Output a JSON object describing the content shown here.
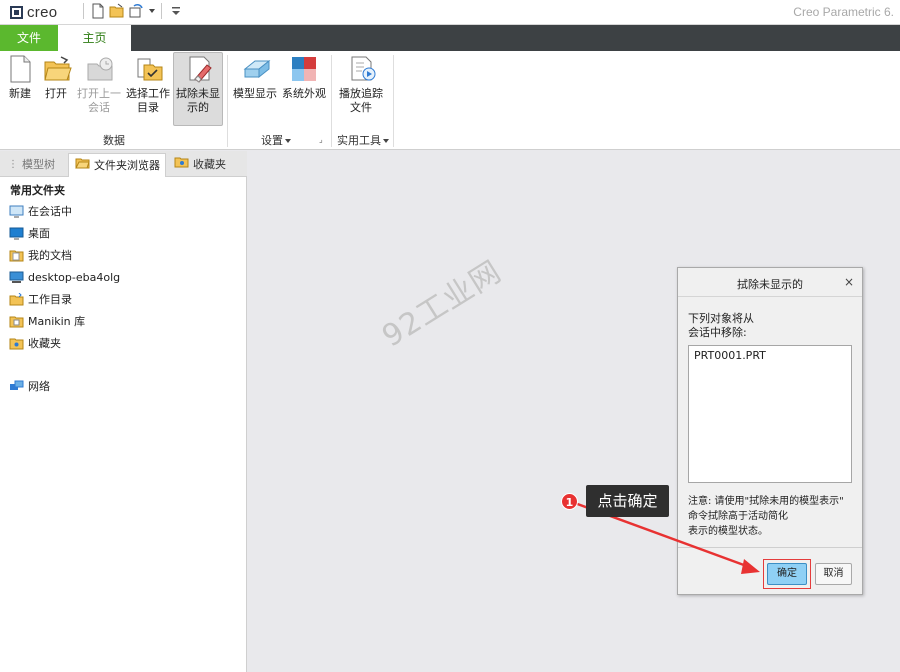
{
  "app": {
    "logo_text": "creo",
    "title": "Creo Parametric 6."
  },
  "tabs": {
    "file": "文件",
    "home": "主页"
  },
  "ribbon": {
    "new": "新建",
    "open": "打开",
    "open_last_l1": "打开上一",
    "open_last_l2": "会话",
    "select_dir_l1": "选择工作",
    "select_dir_l2": "目录",
    "erase_l1": "拭除未显",
    "erase_l2": "示的",
    "group_data": "数据",
    "model_display": "模型显示",
    "system_appearance": "系统外观",
    "group_settings": "设置",
    "playback_l1": "播放追踪",
    "playback_l2": "文件",
    "group_utilities": "实用工具"
  },
  "nav": {
    "tab_model_tree": "模型树",
    "tab_folder_browser": "文件夹浏览器",
    "tab_favorites": "收藏夹",
    "heading": "常用文件夹",
    "items": [
      {
        "label": "在会话中",
        "icon": "monitor-icon"
      },
      {
        "label": "桌面",
        "icon": "desktop-icon"
      },
      {
        "label": "我的文档",
        "icon": "documents-icon"
      },
      {
        "label": "desktop-eba4olg",
        "icon": "computer-icon"
      },
      {
        "label": "工作目录",
        "icon": "working-dir-icon"
      },
      {
        "label": "Manikin 库",
        "icon": "library-icon"
      },
      {
        "label": "收藏夹",
        "icon": "favorites-icon"
      },
      {
        "label": "网络",
        "icon": "network-icon"
      }
    ]
  },
  "watermark": "92工业网",
  "dialog": {
    "title": "拭除未显示的",
    "close": "×",
    "msg_l1": "下列对象将从",
    "msg_l2": "会话中移除:",
    "list_item": "PRT0001.PRT",
    "note_l1": "注意: 请使用\"拭除未用的模型表示\"",
    "note_l2": "命令拭除高于活动简化",
    "note_l3": "表示的模型状态。",
    "ok": "确定",
    "cancel": "取消"
  },
  "annotation": {
    "step": "1",
    "text": "点击确定"
  },
  "colors": {
    "file_tab": "#5bb82e",
    "home_tab_text": "#2e7d14",
    "tab_bar": "#3d4144",
    "ok_button": "#8fd0f5",
    "annotation_red": "#e83232"
  }
}
